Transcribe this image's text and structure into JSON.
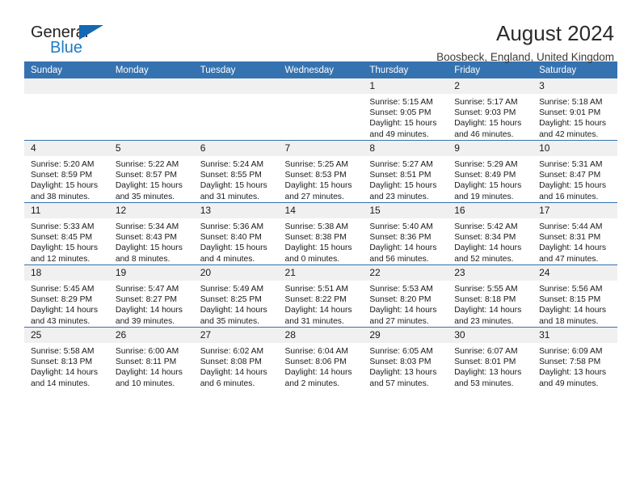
{
  "brand": {
    "line1": "General",
    "line2": "Blue",
    "flag_icon": "triangle-flag-icon",
    "color_primary": "#1268b3",
    "color_text": "#231f20"
  },
  "header": {
    "title": "August 2024",
    "subtitle": "Boosbeck, England, United Kingdom"
  },
  "calendar": {
    "header_bg": "#3572b0",
    "daynum_bg": "#f0f0f0",
    "weekday_headers": [
      "Sunday",
      "Monday",
      "Tuesday",
      "Wednesday",
      "Thursday",
      "Friday",
      "Saturday"
    ],
    "weeks": [
      [
        {
          "day": "",
          "sunrise": "",
          "sunset": "",
          "daylight_line1": "",
          "daylight_line2": ""
        },
        {
          "day": "",
          "sunrise": "",
          "sunset": "",
          "daylight_line1": "",
          "daylight_line2": ""
        },
        {
          "day": "",
          "sunrise": "",
          "sunset": "",
          "daylight_line1": "",
          "daylight_line2": ""
        },
        {
          "day": "",
          "sunrise": "",
          "sunset": "",
          "daylight_line1": "",
          "daylight_line2": ""
        },
        {
          "day": "1",
          "sunrise": "Sunrise: 5:15 AM",
          "sunset": "Sunset: 9:05 PM",
          "daylight_line1": "Daylight: 15 hours",
          "daylight_line2": "and 49 minutes."
        },
        {
          "day": "2",
          "sunrise": "Sunrise: 5:17 AM",
          "sunset": "Sunset: 9:03 PM",
          "daylight_line1": "Daylight: 15 hours",
          "daylight_line2": "and 46 minutes."
        },
        {
          "day": "3",
          "sunrise": "Sunrise: 5:18 AM",
          "sunset": "Sunset: 9:01 PM",
          "daylight_line1": "Daylight: 15 hours",
          "daylight_line2": "and 42 minutes."
        }
      ],
      [
        {
          "day": "4",
          "sunrise": "Sunrise: 5:20 AM",
          "sunset": "Sunset: 8:59 PM",
          "daylight_line1": "Daylight: 15 hours",
          "daylight_line2": "and 38 minutes."
        },
        {
          "day": "5",
          "sunrise": "Sunrise: 5:22 AM",
          "sunset": "Sunset: 8:57 PM",
          "daylight_line1": "Daylight: 15 hours",
          "daylight_line2": "and 35 minutes."
        },
        {
          "day": "6",
          "sunrise": "Sunrise: 5:24 AM",
          "sunset": "Sunset: 8:55 PM",
          "daylight_line1": "Daylight: 15 hours",
          "daylight_line2": "and 31 minutes."
        },
        {
          "day": "7",
          "sunrise": "Sunrise: 5:25 AM",
          "sunset": "Sunset: 8:53 PM",
          "daylight_line1": "Daylight: 15 hours",
          "daylight_line2": "and 27 minutes."
        },
        {
          "day": "8",
          "sunrise": "Sunrise: 5:27 AM",
          "sunset": "Sunset: 8:51 PM",
          "daylight_line1": "Daylight: 15 hours",
          "daylight_line2": "and 23 minutes."
        },
        {
          "day": "9",
          "sunrise": "Sunrise: 5:29 AM",
          "sunset": "Sunset: 8:49 PM",
          "daylight_line1": "Daylight: 15 hours",
          "daylight_line2": "and 19 minutes."
        },
        {
          "day": "10",
          "sunrise": "Sunrise: 5:31 AM",
          "sunset": "Sunset: 8:47 PM",
          "daylight_line1": "Daylight: 15 hours",
          "daylight_line2": "and 16 minutes."
        }
      ],
      [
        {
          "day": "11",
          "sunrise": "Sunrise: 5:33 AM",
          "sunset": "Sunset: 8:45 PM",
          "daylight_line1": "Daylight: 15 hours",
          "daylight_line2": "and 12 minutes."
        },
        {
          "day": "12",
          "sunrise": "Sunrise: 5:34 AM",
          "sunset": "Sunset: 8:43 PM",
          "daylight_line1": "Daylight: 15 hours",
          "daylight_line2": "and 8 minutes."
        },
        {
          "day": "13",
          "sunrise": "Sunrise: 5:36 AM",
          "sunset": "Sunset: 8:40 PM",
          "daylight_line1": "Daylight: 15 hours",
          "daylight_line2": "and 4 minutes."
        },
        {
          "day": "14",
          "sunrise": "Sunrise: 5:38 AM",
          "sunset": "Sunset: 8:38 PM",
          "daylight_line1": "Daylight: 15 hours",
          "daylight_line2": "and 0 minutes."
        },
        {
          "day": "15",
          "sunrise": "Sunrise: 5:40 AM",
          "sunset": "Sunset: 8:36 PM",
          "daylight_line1": "Daylight: 14 hours",
          "daylight_line2": "and 56 minutes."
        },
        {
          "day": "16",
          "sunrise": "Sunrise: 5:42 AM",
          "sunset": "Sunset: 8:34 PM",
          "daylight_line1": "Daylight: 14 hours",
          "daylight_line2": "and 52 minutes."
        },
        {
          "day": "17",
          "sunrise": "Sunrise: 5:44 AM",
          "sunset": "Sunset: 8:31 PM",
          "daylight_line1": "Daylight: 14 hours",
          "daylight_line2": "and 47 minutes."
        }
      ],
      [
        {
          "day": "18",
          "sunrise": "Sunrise: 5:45 AM",
          "sunset": "Sunset: 8:29 PM",
          "daylight_line1": "Daylight: 14 hours",
          "daylight_line2": "and 43 minutes."
        },
        {
          "day": "19",
          "sunrise": "Sunrise: 5:47 AM",
          "sunset": "Sunset: 8:27 PM",
          "daylight_line1": "Daylight: 14 hours",
          "daylight_line2": "and 39 minutes."
        },
        {
          "day": "20",
          "sunrise": "Sunrise: 5:49 AM",
          "sunset": "Sunset: 8:25 PM",
          "daylight_line1": "Daylight: 14 hours",
          "daylight_line2": "and 35 minutes."
        },
        {
          "day": "21",
          "sunrise": "Sunrise: 5:51 AM",
          "sunset": "Sunset: 8:22 PM",
          "daylight_line1": "Daylight: 14 hours",
          "daylight_line2": "and 31 minutes."
        },
        {
          "day": "22",
          "sunrise": "Sunrise: 5:53 AM",
          "sunset": "Sunset: 8:20 PM",
          "daylight_line1": "Daylight: 14 hours",
          "daylight_line2": "and 27 minutes."
        },
        {
          "day": "23",
          "sunrise": "Sunrise: 5:55 AM",
          "sunset": "Sunset: 8:18 PM",
          "daylight_line1": "Daylight: 14 hours",
          "daylight_line2": "and 23 minutes."
        },
        {
          "day": "24",
          "sunrise": "Sunrise: 5:56 AM",
          "sunset": "Sunset: 8:15 PM",
          "daylight_line1": "Daylight: 14 hours",
          "daylight_line2": "and 18 minutes."
        }
      ],
      [
        {
          "day": "25",
          "sunrise": "Sunrise: 5:58 AM",
          "sunset": "Sunset: 8:13 PM",
          "daylight_line1": "Daylight: 14 hours",
          "daylight_line2": "and 14 minutes."
        },
        {
          "day": "26",
          "sunrise": "Sunrise: 6:00 AM",
          "sunset": "Sunset: 8:11 PM",
          "daylight_line1": "Daylight: 14 hours",
          "daylight_line2": "and 10 minutes."
        },
        {
          "day": "27",
          "sunrise": "Sunrise: 6:02 AM",
          "sunset": "Sunset: 8:08 PM",
          "daylight_line1": "Daylight: 14 hours",
          "daylight_line2": "and 6 minutes."
        },
        {
          "day": "28",
          "sunrise": "Sunrise: 6:04 AM",
          "sunset": "Sunset: 8:06 PM",
          "daylight_line1": "Daylight: 14 hours",
          "daylight_line2": "and 2 minutes."
        },
        {
          "day": "29",
          "sunrise": "Sunrise: 6:05 AM",
          "sunset": "Sunset: 8:03 PM",
          "daylight_line1": "Daylight: 13 hours",
          "daylight_line2": "and 57 minutes."
        },
        {
          "day": "30",
          "sunrise": "Sunrise: 6:07 AM",
          "sunset": "Sunset: 8:01 PM",
          "daylight_line1": "Daylight: 13 hours",
          "daylight_line2": "and 53 minutes."
        },
        {
          "day": "31",
          "sunrise": "Sunrise: 6:09 AM",
          "sunset": "Sunset: 7:58 PM",
          "daylight_line1": "Daylight: 13 hours",
          "daylight_line2": "and 49 minutes."
        }
      ]
    ]
  }
}
